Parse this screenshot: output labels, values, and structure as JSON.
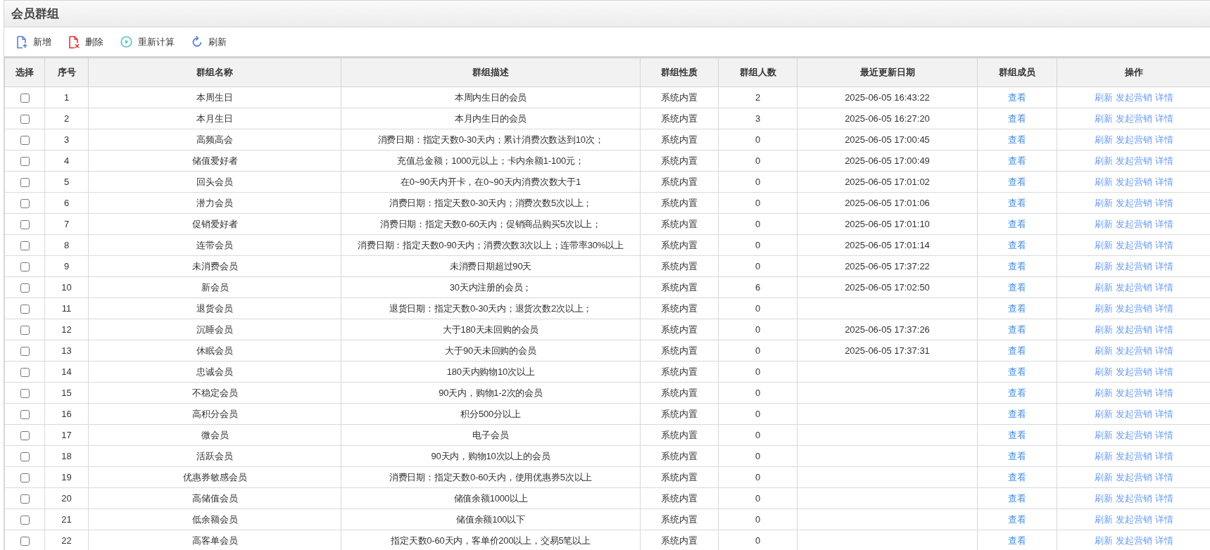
{
  "panel": {
    "title": "会员群组"
  },
  "toolbar": [
    {
      "kind": "add",
      "label": "新增"
    },
    {
      "kind": "delete",
      "label": "删除"
    },
    {
      "kind": "recalc",
      "label": "重新计算"
    },
    {
      "kind": "refresh",
      "label": "刷新"
    }
  ],
  "table": {
    "columns": [
      "选择",
      "序号",
      "群组名称",
      "群组描述",
      "群组性质",
      "群组人数",
      "最近更新日期",
      "群组成员",
      "操作"
    ],
    "rows": [
      {
        "checked": false,
        "no": "1",
        "name": "本周生日",
        "desc": "本周内生日的会员",
        "type": "系统内置",
        "count": "2",
        "updated": "2025-06-05 16:43:22",
        "members": "查看",
        "actions": [
          "刷新",
          "发起营销",
          "详情"
        ]
      },
      {
        "checked": false,
        "no": "2",
        "name": "本月生日",
        "desc": "本月内生日的会员",
        "type": "系统内置",
        "count": "3",
        "updated": "2025-06-05 16:27:20",
        "members": "查看",
        "actions": [
          "刷新",
          "发起营销",
          "详情"
        ]
      },
      {
        "checked": false,
        "no": "3",
        "name": "高频高会",
        "desc": "消费日期：指定天数0-30天内；累计消费次数达到10次；",
        "type": "系统内置",
        "count": "0",
        "updated": "2025-06-05 17:00:45",
        "members": "查看",
        "actions": [
          "刷新",
          "发起营销",
          "详情"
        ]
      },
      {
        "checked": false,
        "no": "4",
        "name": "储值爱好者",
        "desc": "充值总金额；1000元以上；卡内余额1-100元；",
        "type": "系统内置",
        "count": "0",
        "updated": "2025-06-05 17:00:49",
        "members": "查看",
        "actions": [
          "刷新",
          "发起营销",
          "详情"
        ]
      },
      {
        "checked": false,
        "no": "5",
        "name": "回头会员",
        "desc": "在0~90天内开卡，在0~90天内消费次数大于1",
        "type": "系统内置",
        "count": "0",
        "updated": "2025-06-05 17:01:02",
        "members": "查看",
        "actions": [
          "刷新",
          "发起营销",
          "详情"
        ]
      },
      {
        "checked": false,
        "no": "6",
        "name": "潜力会员",
        "desc": "消费日期：指定天数0-30天内；消费次数5次以上；",
        "type": "系统内置",
        "count": "0",
        "updated": "2025-06-05 17:01:06",
        "members": "查看",
        "actions": [
          "刷新",
          "发起营销",
          "详情"
        ]
      },
      {
        "checked": false,
        "no": "7",
        "name": "促销爱好者",
        "desc": "消费日期：指定天数0-60天内；促销商品购买5次以上；",
        "type": "系统内置",
        "count": "0",
        "updated": "2025-06-05 17:01:10",
        "members": "查看",
        "actions": [
          "刷新",
          "发起营销",
          "详情"
        ]
      },
      {
        "checked": false,
        "no": "8",
        "name": "连带会员",
        "desc": "消费日期：指定天数0-90天内；消费次数3次以上；连带率30%以上",
        "type": "系统内置",
        "count": "0",
        "updated": "2025-06-05 17:01:14",
        "members": "查看",
        "actions": [
          "刷新",
          "发起营销",
          "详情"
        ]
      },
      {
        "checked": false,
        "no": "9",
        "name": "未消费会员",
        "desc": "未消费日期超过90天",
        "type": "系统内置",
        "count": "0",
        "updated": "2025-06-05 17:37:22",
        "members": "查看",
        "actions": [
          "刷新",
          "发起营销",
          "详情"
        ]
      },
      {
        "checked": false,
        "no": "10",
        "name": "新会员",
        "desc": "30天内注册的会员；",
        "type": "系统内置",
        "count": "6",
        "updated": "2025-06-05 17:02:50",
        "members": "查看",
        "actions": [
          "刷新",
          "发起营销",
          "详情"
        ]
      },
      {
        "checked": false,
        "no": "11",
        "name": "退货会员",
        "desc": "退货日期：指定天数0-30天内；退货次数2次以上；",
        "type": "系统内置",
        "count": "0",
        "members": "查看",
        "actions": [
          "刷新",
          "发起营销",
          "详情"
        ]
      },
      {
        "checked": false,
        "no": "12",
        "name": "沉睡会员",
        "desc": "大于180天未回购的会员",
        "type": "系统内置",
        "count": "0",
        "updated": "2025-06-05 17:37:26",
        "members": "查看",
        "actions": [
          "刷新",
          "发起营销",
          "详情"
        ]
      },
      {
        "checked": false,
        "no": "13",
        "name": "休眠会员",
        "desc": "大于90天未回购的会员",
        "type": "系统内置",
        "count": "0",
        "updated": "2025-06-05 17:37:31",
        "members": "查看",
        "actions": [
          "刷新",
          "发起营销",
          "详情"
        ]
      },
      {
        "checked": false,
        "no": "14",
        "name": "忠诚会员",
        "desc": "180天内购物10次以上",
        "type": "系统内置",
        "count": "0",
        "members": "查看",
        "actions": [
          "刷新",
          "发起营销",
          "详情"
        ]
      },
      {
        "checked": false,
        "no": "15",
        "name": "不稳定会员",
        "desc": "90天内，购物1-2次的会员",
        "type": "系统内置",
        "count": "0",
        "members": "查看",
        "actions": [
          "刷新",
          "发起营销",
          "详情"
        ]
      },
      {
        "checked": false,
        "no": "16",
        "name": "高积分会员",
        "desc": "积分500分以上",
        "type": "系统内置",
        "count": "0",
        "members": "查看",
        "actions": [
          "刷新",
          "发起营销",
          "详情"
        ]
      },
      {
        "checked": false,
        "no": "17",
        "name": "微会员",
        "desc": "电子会员",
        "type": "系统内置",
        "count": "0",
        "members": "查看",
        "actions": [
          "刷新",
          "发起营销",
          "详情"
        ]
      },
      {
        "checked": false,
        "no": "18",
        "name": "活跃会员",
        "desc": "90天内，购物10次以上的会员",
        "type": "系统内置",
        "count": "0",
        "members": "查看",
        "actions": [
          "刷新",
          "发起营销",
          "详情"
        ]
      },
      {
        "checked": false,
        "no": "19",
        "name": "优惠券敏感会员",
        "desc": "消费日期：指定天数0-60天内，使用优惠券5次以上",
        "type": "系统内置",
        "count": "0",
        "members": "查看",
        "actions": [
          "刷新",
          "发起营销",
          "详情"
        ]
      },
      {
        "checked": false,
        "no": "20",
        "name": "高储值会员",
        "desc": "储值余额1000以上",
        "type": "系统内置",
        "count": "0",
        "members": "查看",
        "actions": [
          "刷新",
          "发起营销",
          "详情"
        ]
      },
      {
        "checked": false,
        "no": "21",
        "name": "低余额会员",
        "desc": "储值余额100以下",
        "type": "系统内置",
        "count": "0",
        "members": "查看",
        "actions": [
          "刷新",
          "发起营销",
          "详情"
        ]
      },
      {
        "checked": false,
        "no": "22",
        "name": "高客单会员",
        "desc": "指定天数0-60天内，客单价200以上，交易5笔以上",
        "type": "系统内置",
        "count": "0",
        "members": "查看",
        "actions": [
          "刷新",
          "发起营销",
          "详情"
        ]
      }
    ]
  }
}
